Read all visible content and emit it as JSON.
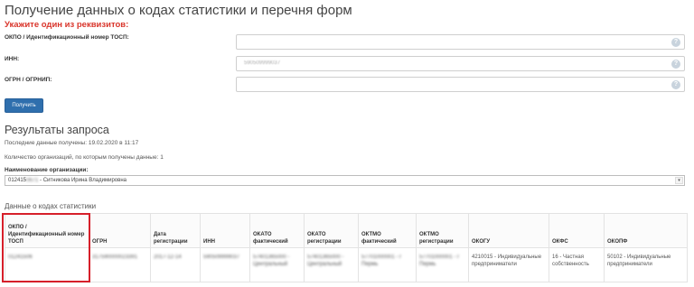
{
  "page": {
    "title": "Получение данных о кодах статистики и перечня форм",
    "hint": "Укажите один из реквизитов:"
  },
  "form": {
    "fields": [
      {
        "label": "ОКПО / Идентификационный номер ТОСП:",
        "value": ""
      },
      {
        "label": "ИНН:",
        "value": "590509999037"
      },
      {
        "label": "ОГРН / ОГРНИП:",
        "value": ""
      }
    ],
    "help_icon": "?",
    "submit_label": "Получить"
  },
  "results": {
    "title": "Результаты запроса",
    "last_received": "Последние данные получены: 19.02.2020 в 11:17",
    "org_count": "Количество организаций, по которым получены данные: 1",
    "org_name_label": "Наименование организации:",
    "org_select_prefix": "012415",
    "org_select_masked": "0671",
    "org_select_suffix": " - Ситникова Ирина Владимировна",
    "select_arrow": "▾"
  },
  "stats": {
    "title": "Данные о кодах статистики",
    "headers": [
      "ОКПО / Идентификационный номер ТОСП",
      "ОГРН",
      "Дата регистрации",
      "ИНН",
      "ОКАТО фактический",
      "ОКАТО регистрации",
      "ОКТМО фактический",
      "ОКТМО регистрации",
      "ОКОГУ",
      "ОКФС",
      "ОКОПФ"
    ],
    "row": {
      "okpo": "01241506",
      "ogrn": "317590000023391",
      "reg_date": "2017-12-14",
      "inn": "590509999037",
      "okato_fact": "57401365000 - Центральный",
      "okato_reg": "57401365000 - Центральный",
      "oktmo_fact": "57701000001 - г Пермь",
      "oktmo_reg": "57701000001 - г Пермь",
      "okogu": "4210015 - Индивидуальные предприниматели",
      "okfs": "16 - Частная собственность",
      "okopf": "50102 - Индивидуальные предприниматели"
    }
  },
  "colors": {
    "accent": "#2f6fad",
    "hint": "#d9352b",
    "highlight": "#d61f2a"
  }
}
